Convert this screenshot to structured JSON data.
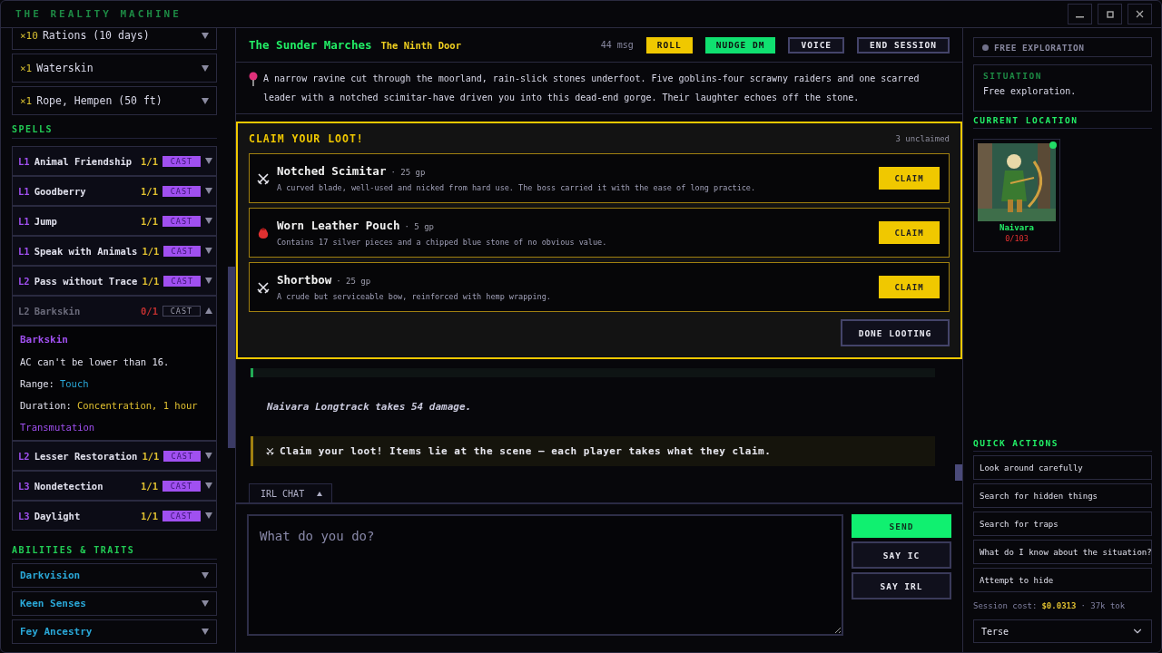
{
  "window": {
    "title": "THE REALITY MACHINE"
  },
  "sidebar": {
    "inventory": [
      {
        "qty": "×10",
        "name": "Rations (10 days)"
      },
      {
        "qty": "×1",
        "name": "Waterskin"
      },
      {
        "qty": "×1",
        "name": "Rope, Hempen (50 ft)"
      }
    ],
    "spells_heading": "SPELLS",
    "spells": [
      {
        "level": "L1",
        "name": "Animal Friendship",
        "slots": "1/1",
        "action": "CAST",
        "available": true,
        "expanded": false
      },
      {
        "level": "L1",
        "name": "Goodberry",
        "slots": "1/1",
        "action": "CAST",
        "available": true,
        "expanded": false
      },
      {
        "level": "L1",
        "name": "Jump",
        "slots": "1/1",
        "action": "CAST",
        "available": true,
        "expanded": false
      },
      {
        "level": "L1",
        "name": "Speak with Animals",
        "slots": "1/1",
        "action": "CAST",
        "available": true,
        "expanded": false
      },
      {
        "level": "L2",
        "name": "Pass without Trace",
        "slots": "1/1",
        "action": "CAST",
        "available": true,
        "expanded": false
      },
      {
        "level": "L2",
        "name": "Barkskin",
        "slots": "0/1",
        "action": "CAST",
        "available": false,
        "expanded": true,
        "detail": {
          "title": "Barkskin",
          "description": "AC can't be lower than 16.",
          "range_label": "Range:",
          "range": "Touch",
          "duration_label": "Duration:",
          "duration": "Concentration, 1 hour",
          "school": "Transmutation"
        }
      },
      {
        "level": "L2",
        "name": "Lesser Restoration",
        "slots": "1/1",
        "action": "CAST",
        "available": true,
        "expanded": false
      },
      {
        "level": "L3",
        "name": "Nondetection",
        "slots": "1/1",
        "action": "CAST",
        "available": true,
        "expanded": false
      },
      {
        "level": "L3",
        "name": "Daylight",
        "slots": "1/1",
        "action": "CAST",
        "available": true,
        "expanded": false
      }
    ],
    "abilities_heading": "ABILITIES & TRAITS",
    "abilities": [
      {
        "name": "Darkvision"
      },
      {
        "name": "Keen Senses"
      },
      {
        "name": "Fey Ancestry"
      }
    ]
  },
  "header": {
    "title": "The Sunder Marches",
    "subtitle": "The Ninth Door",
    "count": "44 msg",
    "buttons": [
      {
        "label": "ROLL",
        "kind": "gold"
      },
      {
        "label": "NUDGE DM",
        "kind": "green"
      },
      {
        "label": "VOICE",
        "kind": "plain"
      },
      {
        "label": "END SESSION",
        "kind": "plain"
      }
    ]
  },
  "scene": "A narrow ravine cut through the moorland, rain-slick stones underfoot. Five goblins-four scrawny raiders and one scarred leader with a notched scimitar-have driven you into this dead-end gorge. Their laughter echoes off the stone.",
  "loot": {
    "title": "CLAIM YOUR LOOT!",
    "count": "3 unclaimed",
    "items": [
      {
        "kind": "weapon",
        "name": "Notched Scimitar",
        "price": "· 25 gp",
        "description": "A curved blade, well-used and nicked from hard use. The boss carried it with the ease of long practice.",
        "action": "CLAIM"
      },
      {
        "kind": "pouch",
        "name": "Worn Leather Pouch",
        "price": "· 5 gp",
        "description": "Contains 17 silver pieces and a chipped blue stone of no obvious value.",
        "action": "CLAIM"
      },
      {
        "kind": "weapon",
        "name": "Shortbow",
        "price": "· 25 gp",
        "description": "A crude but serviceable bow, reinforced with hemp wrapping.",
        "action": "CLAIM"
      }
    ],
    "done": "DONE LOOTING"
  },
  "log": [
    {
      "kind": "narration",
      "text": "Naivara Longtrack takes 54 damage."
    },
    {
      "kind": "system",
      "text": "Claim your loot! Items lie at the scene — each player takes what they claim."
    }
  ],
  "chat_tab": {
    "label": "IRL CHAT",
    "expanded": false
  },
  "composer": {
    "placeholder": "What do you do?",
    "buttons": [
      {
        "label": "SEND",
        "kind": "primary"
      },
      {
        "label": "SAY IC",
        "kind": "plain"
      },
      {
        "label": "SAY IRL",
        "kind": "plain"
      }
    ]
  },
  "right": {
    "mode": "FREE EXPLORATION",
    "situation_heading": "SITUATION",
    "situation": "Free exploration.",
    "location_heading": "CURRENT LOCATION",
    "characters": [
      {
        "name": "Naivara",
        "hp": "0/103",
        "online": true
      }
    ],
    "quick_heading": "QUICK ACTIONS",
    "quick_actions": [
      "Look around carefully",
      "Search for hidden things",
      "Search for traps",
      "What do I know about the situation?",
      "Attempt to hide"
    ],
    "cost_label": "Session cost:",
    "cost": "$0.0313",
    "tokens": "· 37k tok",
    "verbosity": "Terse"
  }
}
